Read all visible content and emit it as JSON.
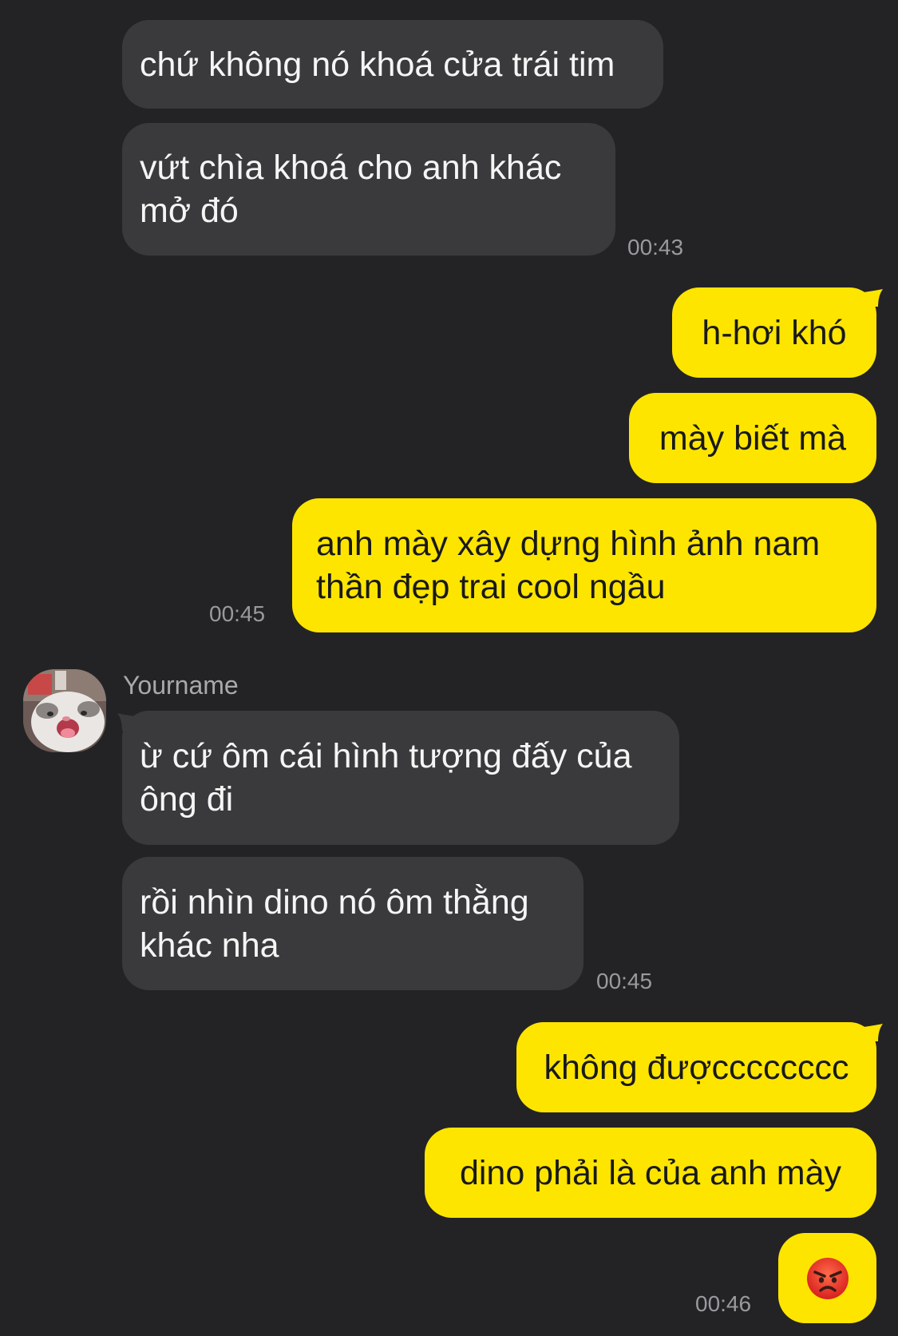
{
  "conversation": {
    "contact_name": "Yourname",
    "avatar_icon": "cat-avatar-icon",
    "messages": [
      {
        "direction": "in",
        "lines": [
          "chứ không nó khoá cửa trái tim"
        ]
      },
      {
        "direction": "in",
        "lines": [
          "vứt chìa khoá cho anh khác",
          "mở đó"
        ],
        "time": "00:43"
      },
      {
        "direction": "out",
        "lines": [
          "h-hơi khó"
        ]
      },
      {
        "direction": "out",
        "lines": [
          "mày biết mà"
        ]
      },
      {
        "direction": "out",
        "lines": [
          "anh mày xây dựng hình ảnh nam",
          "thần đẹp trai cool ngầu"
        ],
        "time": "00:45"
      },
      {
        "direction": "in",
        "lines": [
          "ừ cứ ôm cái hình tượng đấy của",
          "ông đi"
        ]
      },
      {
        "direction": "in",
        "lines": [
          "rồi nhìn dino nó ôm thằng",
          "khác nha"
        ],
        "time": "00:45"
      },
      {
        "direction": "out",
        "lines": [
          "không đượcccccccc"
        ]
      },
      {
        "direction": "out",
        "lines": [
          "dino phải là của anh mày"
        ]
      },
      {
        "direction": "out",
        "emoji": "angry-face-emoji",
        "time": "00:46"
      }
    ]
  },
  "colors": {
    "background": "#232325",
    "incoming_bubble": "#3a3a3c",
    "outgoing_bubble": "#fee500",
    "timestamp": "#9a9a9e"
  }
}
